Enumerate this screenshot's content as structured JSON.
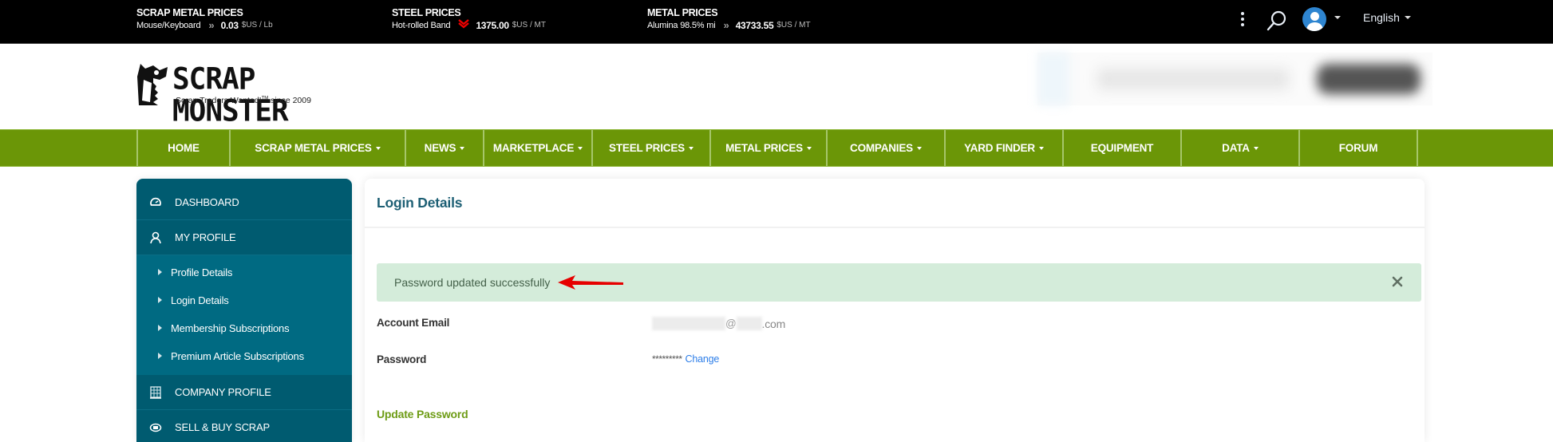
{
  "ticker": [
    {
      "title": "SCRAP METAL PRICES",
      "item": "Mouse/Keyboard",
      "trend": "neutral",
      "trend_icon": "double-chevron-right-icon",
      "value": "0.03",
      "unit": "$US / Lb"
    },
    {
      "title": "STEEL PRICES",
      "item": "Hot-rolled Band",
      "trend": "down",
      "trend_icon": "double-chevron-down-icon",
      "value": "1375.00",
      "unit": "$US / MT"
    },
    {
      "title": "METAL PRICES",
      "item": "Alumina 98.5% mi",
      "trend": "neutral",
      "trend_icon": "double-chevron-right-icon",
      "value": "43733.55",
      "unit": "$US / MT"
    }
  ],
  "topbar": {
    "icons": [
      "kebab-menu-icon",
      "search-icon",
      "user-avatar-icon"
    ],
    "language": "English"
  },
  "logo": {
    "name": "SCRAP MONSTER",
    "tagline": "Scrap Traders Wanted!",
    "tm": "TM",
    "since": " since 2009"
  },
  "nav": [
    {
      "label": "HOME",
      "dropdown": false
    },
    {
      "label": "SCRAP METAL PRICES",
      "dropdown": true
    },
    {
      "label": "NEWS",
      "dropdown": true
    },
    {
      "label": "MARKETPLACE",
      "dropdown": true
    },
    {
      "label": "STEEL PRICES",
      "dropdown": true
    },
    {
      "label": "METAL PRICES",
      "dropdown": true
    },
    {
      "label": "COMPANIES",
      "dropdown": true
    },
    {
      "label": "YARD FINDER",
      "dropdown": true
    },
    {
      "label": "EQUIPMENT",
      "dropdown": false
    },
    {
      "label": "DATA",
      "dropdown": true
    },
    {
      "label": "FORUM",
      "dropdown": false
    }
  ],
  "sidebar": {
    "items": [
      {
        "label": "DASHBOARD",
        "icon": "dashboard-gauge-icon"
      },
      {
        "label": "MY PROFILE",
        "icon": "user-icon"
      }
    ],
    "sub_items": [
      {
        "label": "Profile Details"
      },
      {
        "label": "Login Details"
      },
      {
        "label": "Membership Subscriptions"
      },
      {
        "label": "Premium Article Subscriptions"
      }
    ],
    "after_items": [
      {
        "label": "COMPANY PROFILE",
        "icon": "building-icon"
      },
      {
        "label": "SELL & BUY SCRAP",
        "icon": "handshake-icon"
      }
    ]
  },
  "main": {
    "title": "Login Details",
    "alert": {
      "message": "Password updated successfully",
      "status": "success",
      "color": "#d4ecda"
    },
    "fields": [
      {
        "label": "Account Email",
        "value_at": "@",
        "value_domain_suffix": ".com"
      },
      {
        "label": "Password",
        "value": "*********",
        "action": "Change"
      }
    ],
    "update_password_label": "Update Password"
  },
  "colors": {
    "nav_green": "#6b9607",
    "sidebar_teal": "#005b70",
    "sidebar_sub": "#006a82",
    "title_teal": "#1d5f74",
    "link_blue": "#2d7ee8",
    "update_green": "#6e9c16",
    "annotation_arrow": "#e60000"
  }
}
